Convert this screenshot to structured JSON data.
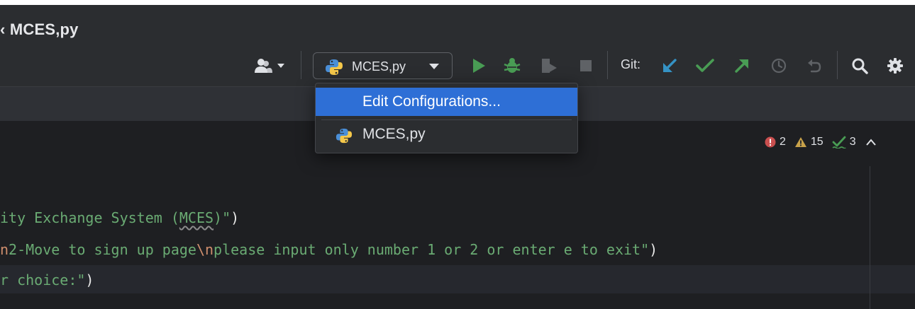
{
  "window": {
    "title": "MCES,py"
  },
  "toolbar": {
    "run_config_label": "MCES,py",
    "git_label": "Git:"
  },
  "popup": {
    "items": [
      {
        "label": "Edit Configurations...",
        "selected": true
      },
      {
        "label": "MCES,py",
        "selected": false
      }
    ]
  },
  "inspections": {
    "errors": "2",
    "warnings": "15",
    "weak_warnings": "3"
  },
  "code": {
    "line1": {
      "pre": "ity Exchange System (",
      "und": "MCES",
      "post": ")\"",
      "close": ")"
    },
    "line2": {
      "esc_start": "n",
      "text1": "2-Move to sign up page",
      "esc": "\\n",
      "text2": "please input only number 1 or 2 or enter e to exit\"",
      "close": ")"
    },
    "line3": {
      "pre": "r choice:\"",
      "close": ")"
    }
  },
  "colors": {
    "accent": "#2e6fd6",
    "run_green": "#499c54",
    "git_blue": "#3592c4",
    "error_red": "#c94f4f",
    "warning_amber": "#c8a24a",
    "string_green": "#6aab73",
    "escape_orange": "#cf8e6d"
  }
}
